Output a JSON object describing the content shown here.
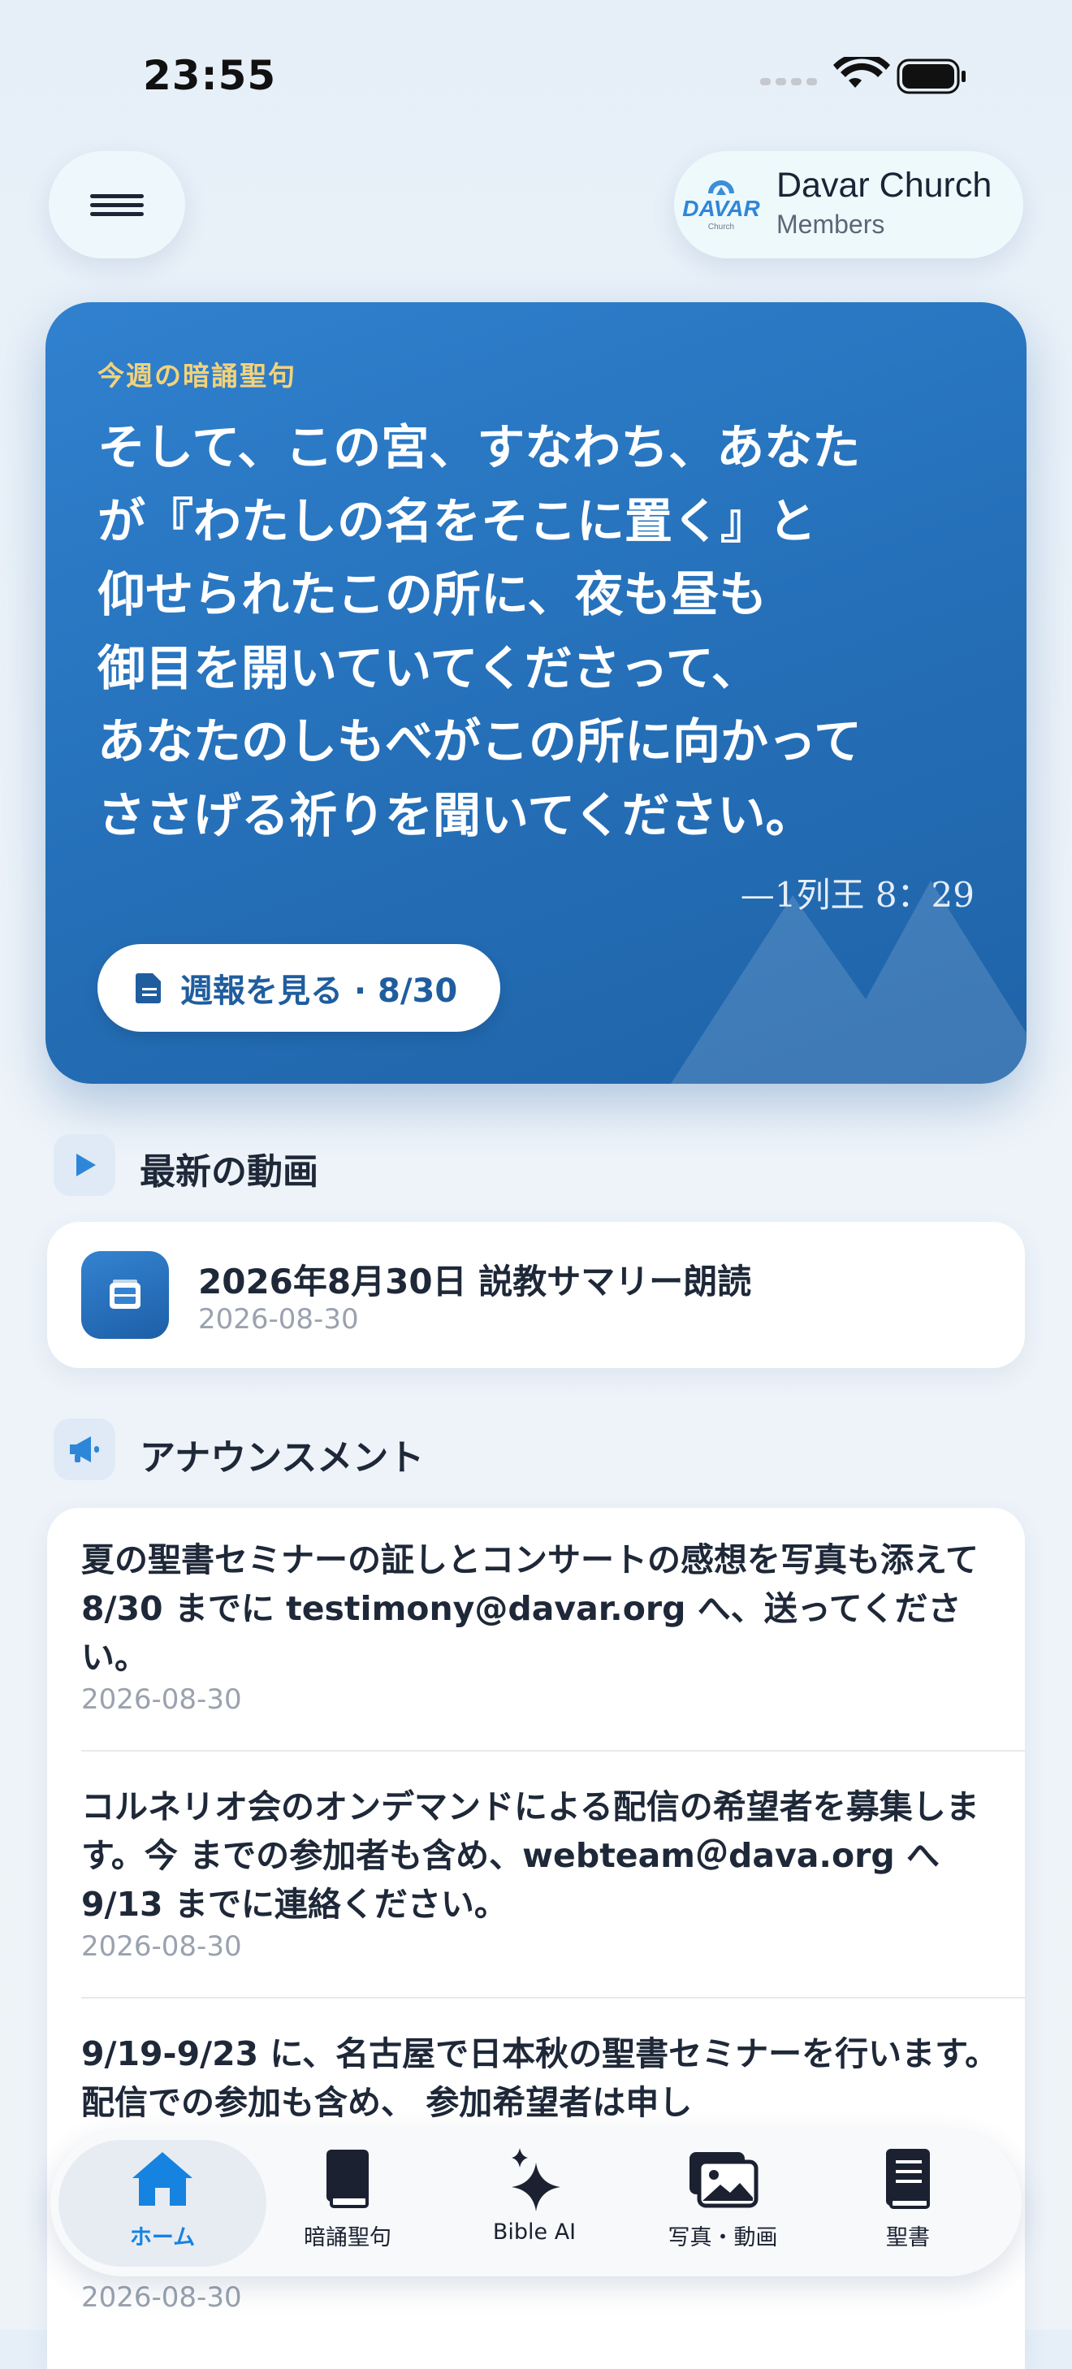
{
  "status_bar": {
    "time": "23:55"
  },
  "header": {
    "church_logo_text": "DAVAR",
    "church_logo_sub": "Church",
    "church_name": "Davar Church",
    "church_subtitle": "Members"
  },
  "verse_card": {
    "label": "今週の暗誦聖句",
    "lines": [
      "そして、この宮、すなわち、あなた",
      "が『わたしの名をそこに置く』と",
      "仰せられたこの所に、夜も昼も",
      "御目を開いていてくださって、",
      "あなたのしもべがこの所に向かって",
      "ささげる祈りを聞いてください。"
    ],
    "reference": "—1列王 8：29",
    "bulletin_button": "週報を見る · 8/30"
  },
  "videos": {
    "section_title": "最新の動画",
    "items": [
      {
        "title": "2026年8月30日 説教サマリー朗読",
        "date": "2026-08-30"
      }
    ]
  },
  "announcements": {
    "section_title": "アナウンスメント",
    "items": [
      {
        "text": "夏の聖書セミナーの証しとコンサートの感想を写真も添えて 8/30 までに testimony@davar.org へ、送ってください。",
        "date": "2026-08-30"
      },
      {
        "text": "コルネリオ会のオンデマンドによる配信の希望者を募集します。今 までの参加者も含め、webteam＠dava.org へ 9/13 までに連絡ください。",
        "date": "2026-08-30"
      },
      {
        "text": "9/19-9/23 に、名古屋で日本秋の聖書セミナーを行います。配信での参加も含め、 参加希望者は申し",
        "date": "2026-08-30"
      }
    ]
  },
  "tabbar": {
    "items": [
      {
        "label": "ホーム",
        "icon": "home-icon",
        "active": true
      },
      {
        "label": "暗誦聖句",
        "icon": "book-icon",
        "active": false
      },
      {
        "label": "Bible AI",
        "icon": "sparkles-icon",
        "active": false
      },
      {
        "label": "写真・動画",
        "icon": "photos-icon",
        "active": false
      },
      {
        "label": "聖書",
        "icon": "bible-icon",
        "active": false
      }
    ]
  },
  "colors": {
    "accent": "#1683e0",
    "card_blue": "#2570b9",
    "verse_label": "#f3d27a"
  }
}
